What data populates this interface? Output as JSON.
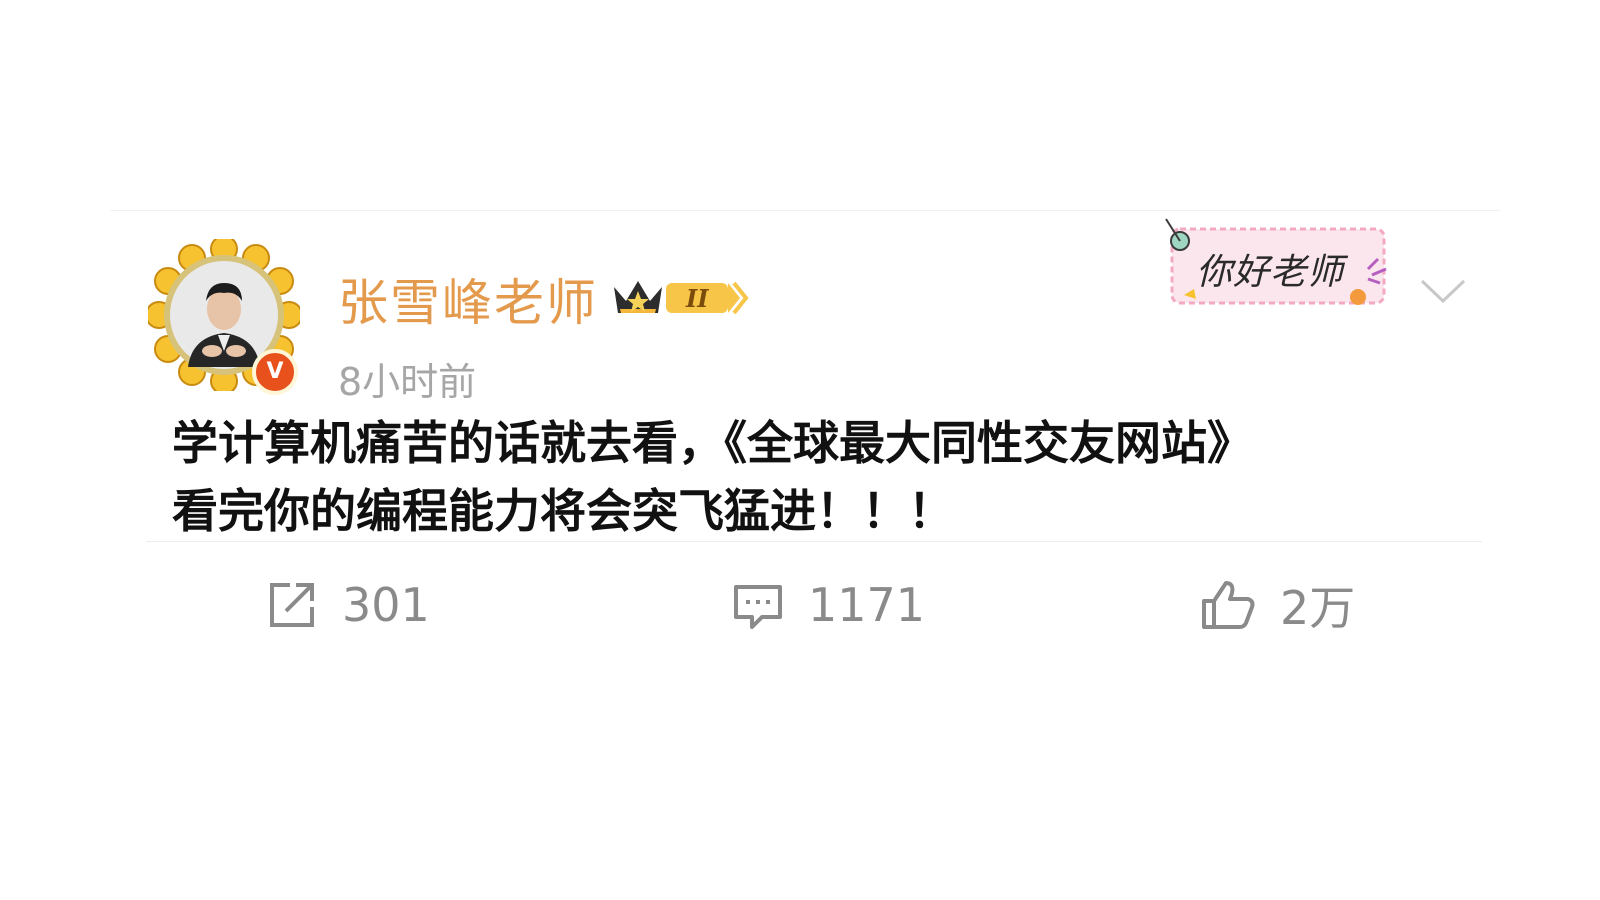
{
  "post": {
    "author": {
      "name": "张雪峰老师",
      "level_badge": "II",
      "verified_mark": "V"
    },
    "timestamp": "8小时前",
    "sticker_text": "你好老师",
    "content": {
      "line1": "学计算机痛苦的话就去看，《全球最大同性交友网站》",
      "line2": "看完你的编程能力将会突飞猛进！！！"
    },
    "actions": {
      "repost_count": "301",
      "comment_count": "1171",
      "like_count": "2万"
    }
  },
  "icons": {
    "repost": "repost-icon",
    "comment": "comment-icon",
    "like": "thumbs-up-icon",
    "menu": "chevron-down-icon",
    "crown": "crown-icon"
  },
  "colors": {
    "username": "#e49a4c",
    "timestamp": "#a6a6a6",
    "body_text": "#111111",
    "action_text": "#8a8a8a",
    "verified_badge": "#e8501c",
    "crown_gold": "#f4b73a"
  }
}
